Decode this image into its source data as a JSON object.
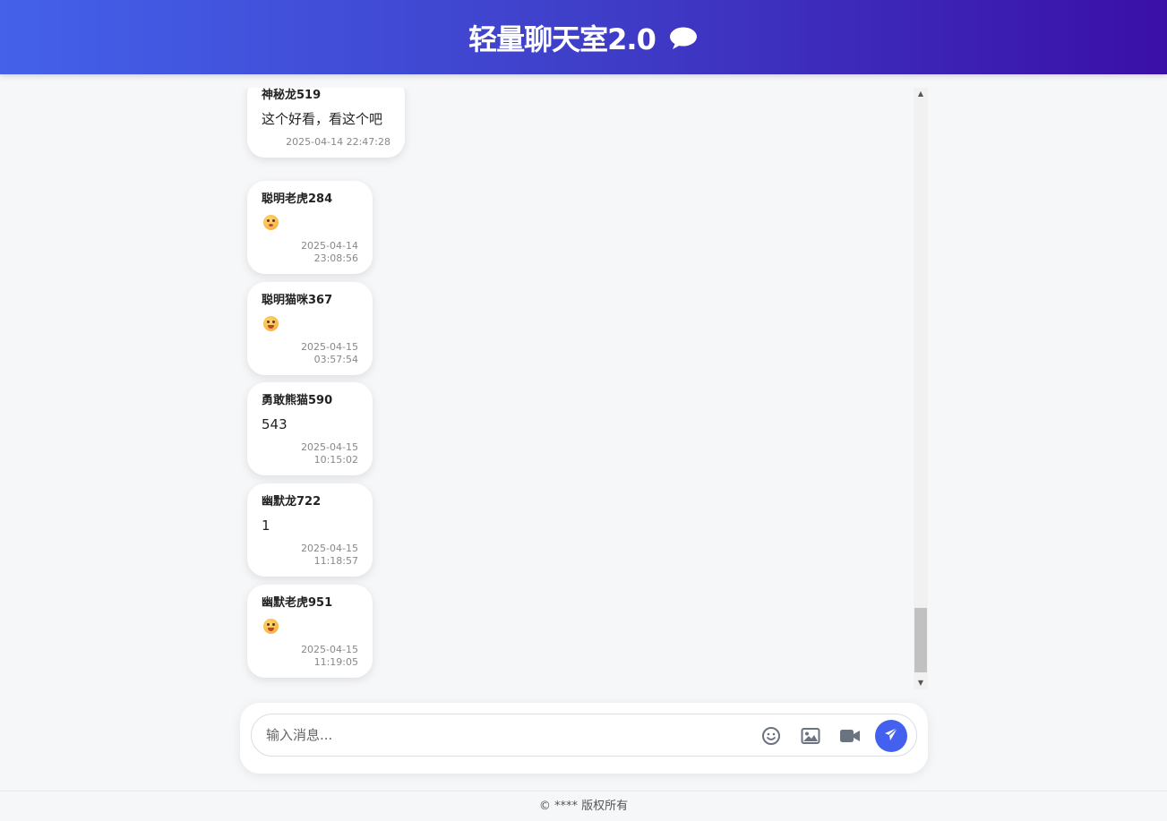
{
  "header": {
    "title": "轻量聊天室2.0",
    "icon": "speech-bubble-icon"
  },
  "messages": [
    {
      "user": "神秘龙519",
      "text": "这个好看，看这个吧",
      "time": "2025-04-14 22:47:28"
    },
    {
      "user": "聪明老虎284",
      "emoji": "flushed-face-emoji",
      "time": "2025-04-14 23:08:56"
    },
    {
      "user": "聪明猫咪367",
      "emoji": "grinning-tongue-emoji",
      "time": "2025-04-15 03:57:54"
    },
    {
      "user": "勇敢熊猫590",
      "text": "543",
      "time": "2025-04-15 10:15:02"
    },
    {
      "user": "幽默龙722",
      "text": "1",
      "time": "2025-04-15 11:18:57"
    },
    {
      "user": "幽默老虎951",
      "emoji": "tongue-wink-emoji",
      "time": "2025-04-15 11:19:05"
    }
  ],
  "input": {
    "placeholder": "输入消息..."
  },
  "toolbar": {
    "icons": [
      "emoji-icon",
      "image-icon",
      "video-icon",
      "send-icon"
    ]
  },
  "colors": {
    "header_start": "#4461ea",
    "header_end": "#3a0fa8",
    "send_button": "#4361ee"
  },
  "footer": {
    "text": "© **** 版权所有"
  }
}
